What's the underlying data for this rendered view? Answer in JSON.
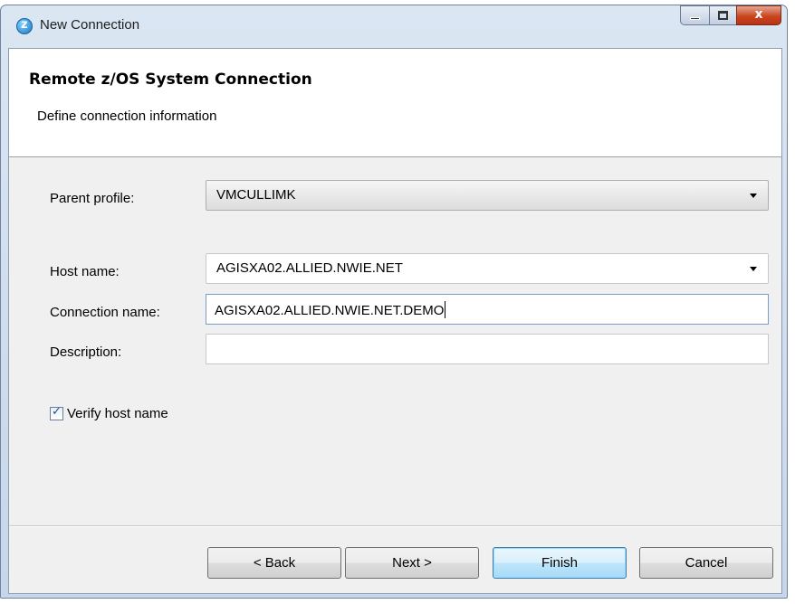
{
  "window": {
    "title": "New Connection",
    "close_glyph": "x"
  },
  "banner": {
    "title": "Remote z/OS System Connection",
    "subtitle": "Define connection information"
  },
  "form": {
    "parent_profile_label": "Parent profile:",
    "parent_profile_value": "VMCULLIMK",
    "host_name_label": "Host name:",
    "host_name_value": "AGISXA02.ALLIED.NWIE.NET",
    "connection_name_label": "Connection name:",
    "connection_name_value": "AGISXA02.ALLIED.NWIE.NET.DEMO",
    "description_label": "Description:",
    "description_value": "",
    "verify_host_label": "Verify host name",
    "verify_host_checked": true
  },
  "buttons": {
    "back": "< Back",
    "next": "Next >",
    "finish": "Finish",
    "cancel": "Cancel"
  },
  "colors": {
    "default_button_border": "#3c7fb1",
    "close_button": "#c9461f"
  }
}
